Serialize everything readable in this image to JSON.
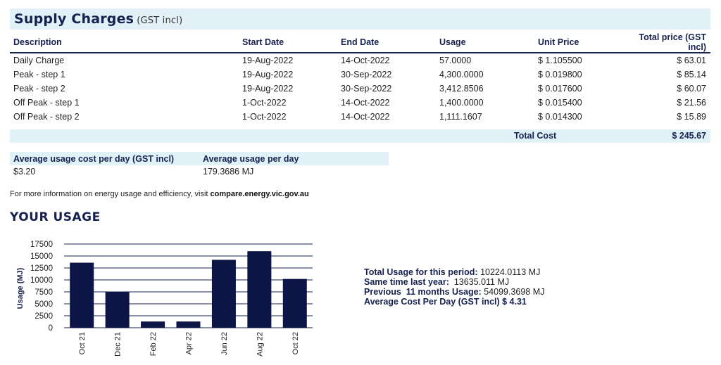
{
  "header": {
    "title": "Supply Charges",
    "subtitle": "(GST incl)"
  },
  "table": {
    "columns": [
      "Description",
      "Start Date",
      "End Date",
      "Usage",
      "Unit Price",
      "Total price (GST incl)"
    ],
    "rows": [
      [
        "Daily Charge",
        "19-Aug-2022",
        "14-Oct-2022",
        "57.0000",
        "$ 1.105500",
        "$ 63.01"
      ],
      [
        "Peak - step 1",
        "19-Aug-2022",
        "30-Sep-2022",
        "4,300.0000",
        "$ 0.019800",
        "$ 85.14"
      ],
      [
        "Peak - step 2",
        "19-Aug-2022",
        "30-Sep-2022",
        "3,412.8506",
        "$ 0.017600",
        "$ 60.07"
      ],
      [
        "Off Peak - step 1",
        "1-Oct-2022",
        "14-Oct-2022",
        "1,400.0000",
        "$ 0.015400",
        "$ 21.56"
      ],
      [
        "Off Peak - step 2",
        "1-Oct-2022",
        "14-Oct-2022",
        "1,111.1607",
        "$ 0.014300",
        "$ 15.89"
      ]
    ]
  },
  "total": {
    "label": "Total Cost",
    "value": "$ 245.67"
  },
  "averages": {
    "cost_label": "Average usage cost per day (GST incl)",
    "cost_value": "$3.20",
    "usage_label": "Average usage per day",
    "usage_value": "179.3686 MJ"
  },
  "info": {
    "prefix": "For more information on energy usage and efficiency, visit ",
    "link": "compare.energy.vic.gov.au"
  },
  "usage_title": "YOUR USAGE",
  "stats": {
    "line1_label": "Total Usage for this period:",
    "line1_value": " 10224.0113 MJ",
    "line2_label": "Same time last year:",
    "line2_value": "  13635.011 MJ",
    "line3_label": "Previous  11 months Usage:",
    "line3_value": " 54099.3698 MJ",
    "line4": "Average Cost Per Day (GST incl) $ 4.31"
  },
  "chart_data": {
    "type": "bar",
    "categories": [
      "Oct 21",
      "Dec 21",
      "Feb 22",
      "Apr 22",
      "Jun 22",
      "Aug 22",
      "Oct 22"
    ],
    "values": [
      13600,
      7500,
      1300,
      1300,
      14200,
      16000,
      10200
    ],
    "ylabel": "Usage (MJ)",
    "ylim": [
      0,
      17500
    ],
    "yticks": [
      "17500",
      "15000",
      "12500",
      "10000",
      "7500",
      "5000",
      "2500",
      "0"
    ],
    "bar_color": "#0d1446",
    "grid": true
  }
}
